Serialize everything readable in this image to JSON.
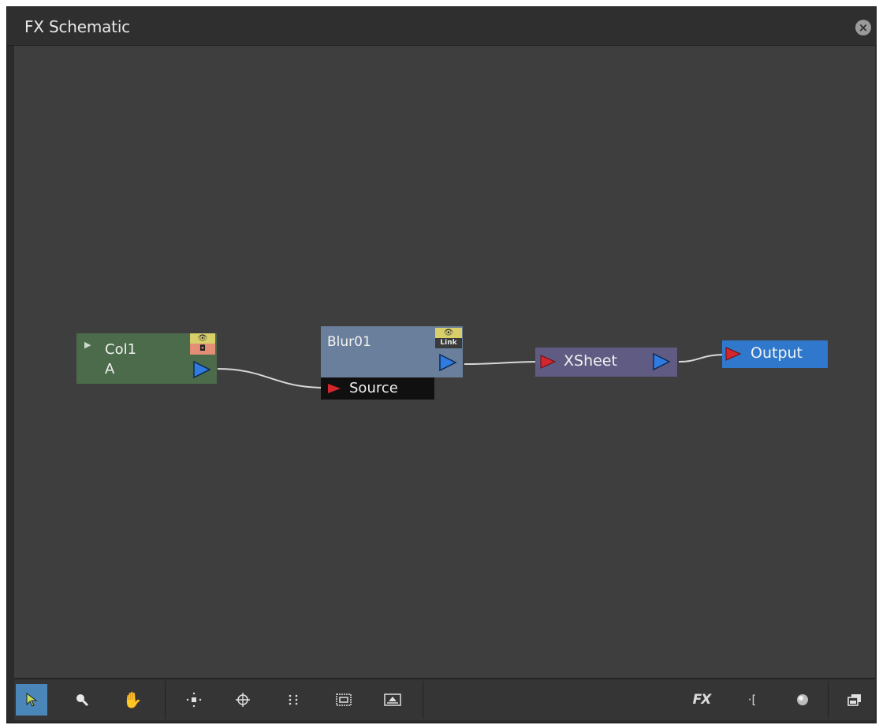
{
  "window": {
    "title": "FX Schematic"
  },
  "nodes": {
    "column": {
      "name": "Col1",
      "sub_label": "A"
    },
    "blur": {
      "name": "Blur01",
      "link_toggle": "Link",
      "input_port_label": "Source"
    },
    "xsheet": {
      "name": "XSheet"
    },
    "output": {
      "name": "Output"
    }
  },
  "toolbar": {
    "fx_label": "FX",
    "bracket_label": "·[",
    "tools": [
      "selection-tool",
      "zoom-tool",
      "hand-tool",
      "fit-to-window",
      "focus-on-current",
      "reorder-nodes",
      "normal-size",
      "maximize-minimize-nodes",
      "insert-fx",
      "output-macro",
      "preview-toggle",
      "swap-schematic"
    ]
  },
  "colors": {
    "column_node": "#4b6b4b",
    "blur_node": "#6a7f9b",
    "xsheet_node": "#5f5b82",
    "output_node": "#2f78cc",
    "port_out": "#2f7be0",
    "port_in": "#d3262d",
    "active_tool": "#4a86b8",
    "canvas_bg": "#3e3e3e"
  }
}
